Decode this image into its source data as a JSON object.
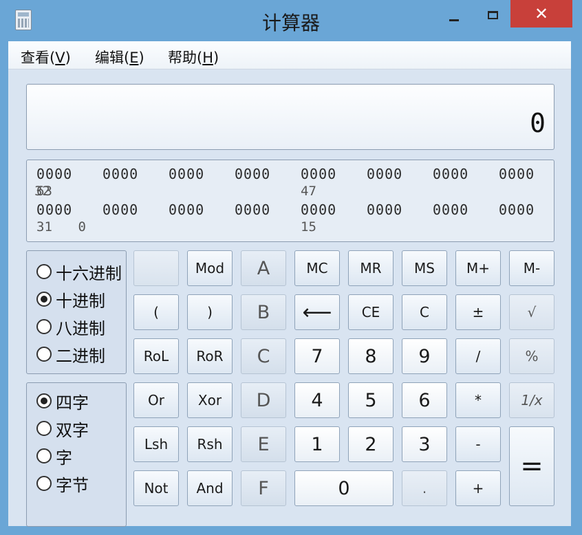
{
  "window": {
    "title": "计算器",
    "close_glyph": "✕"
  },
  "menu": [
    {
      "label": "查看(",
      "key": "V",
      "end": ")"
    },
    {
      "label": "编辑(",
      "key": "E",
      "end": ")"
    },
    {
      "label": "帮助(",
      "key": "H",
      "end": ")"
    }
  ],
  "display": {
    "value": "0"
  },
  "bits": {
    "group": "0000",
    "labels": [
      "63",
      "47",
      "32",
      "31",
      "15",
      "0"
    ]
  },
  "base_options": [
    {
      "label": "十六进制",
      "selected": false
    },
    {
      "label": "十进制",
      "selected": true
    },
    {
      "label": "八进制",
      "selected": false
    },
    {
      "label": "二进制",
      "selected": false
    }
  ],
  "word_options": [
    {
      "label": "四字",
      "selected": true
    },
    {
      "label": "双字",
      "selected": false
    },
    {
      "label": "字",
      "selected": false
    },
    {
      "label": "字节",
      "selected": false
    }
  ],
  "buttons": {
    "blank": "",
    "mod": "Mod",
    "a": "A",
    "mc": "MC",
    "mr": "MR",
    "ms": "MS",
    "mplus": "M+",
    "mminus": "M-",
    "lparen": "(",
    "rparen": ")",
    "b": "B",
    "backspace": "⟵",
    "ce": "CE",
    "c": "C",
    "plusminus": "±",
    "sqrt": "√",
    "rol": "RoL",
    "ror": "RoR",
    "c_hex": "C",
    "d7": "7",
    "d8": "8",
    "d9": "9",
    "div": "/",
    "percent": "%",
    "or": "Or",
    "xor": "Xor",
    "d_hex": "D",
    "d4": "4",
    "d5": "5",
    "d6": "6",
    "mul": "*",
    "recip": "1/x",
    "lsh": "Lsh",
    "rsh": "Rsh",
    "e_hex": "E",
    "d1": "1",
    "d2": "2",
    "d3": "3",
    "sub": "-",
    "equals": "=",
    "not": "Not",
    "and": "And",
    "f_hex": "F",
    "d0": "0",
    "dot": ".",
    "add": "+"
  }
}
